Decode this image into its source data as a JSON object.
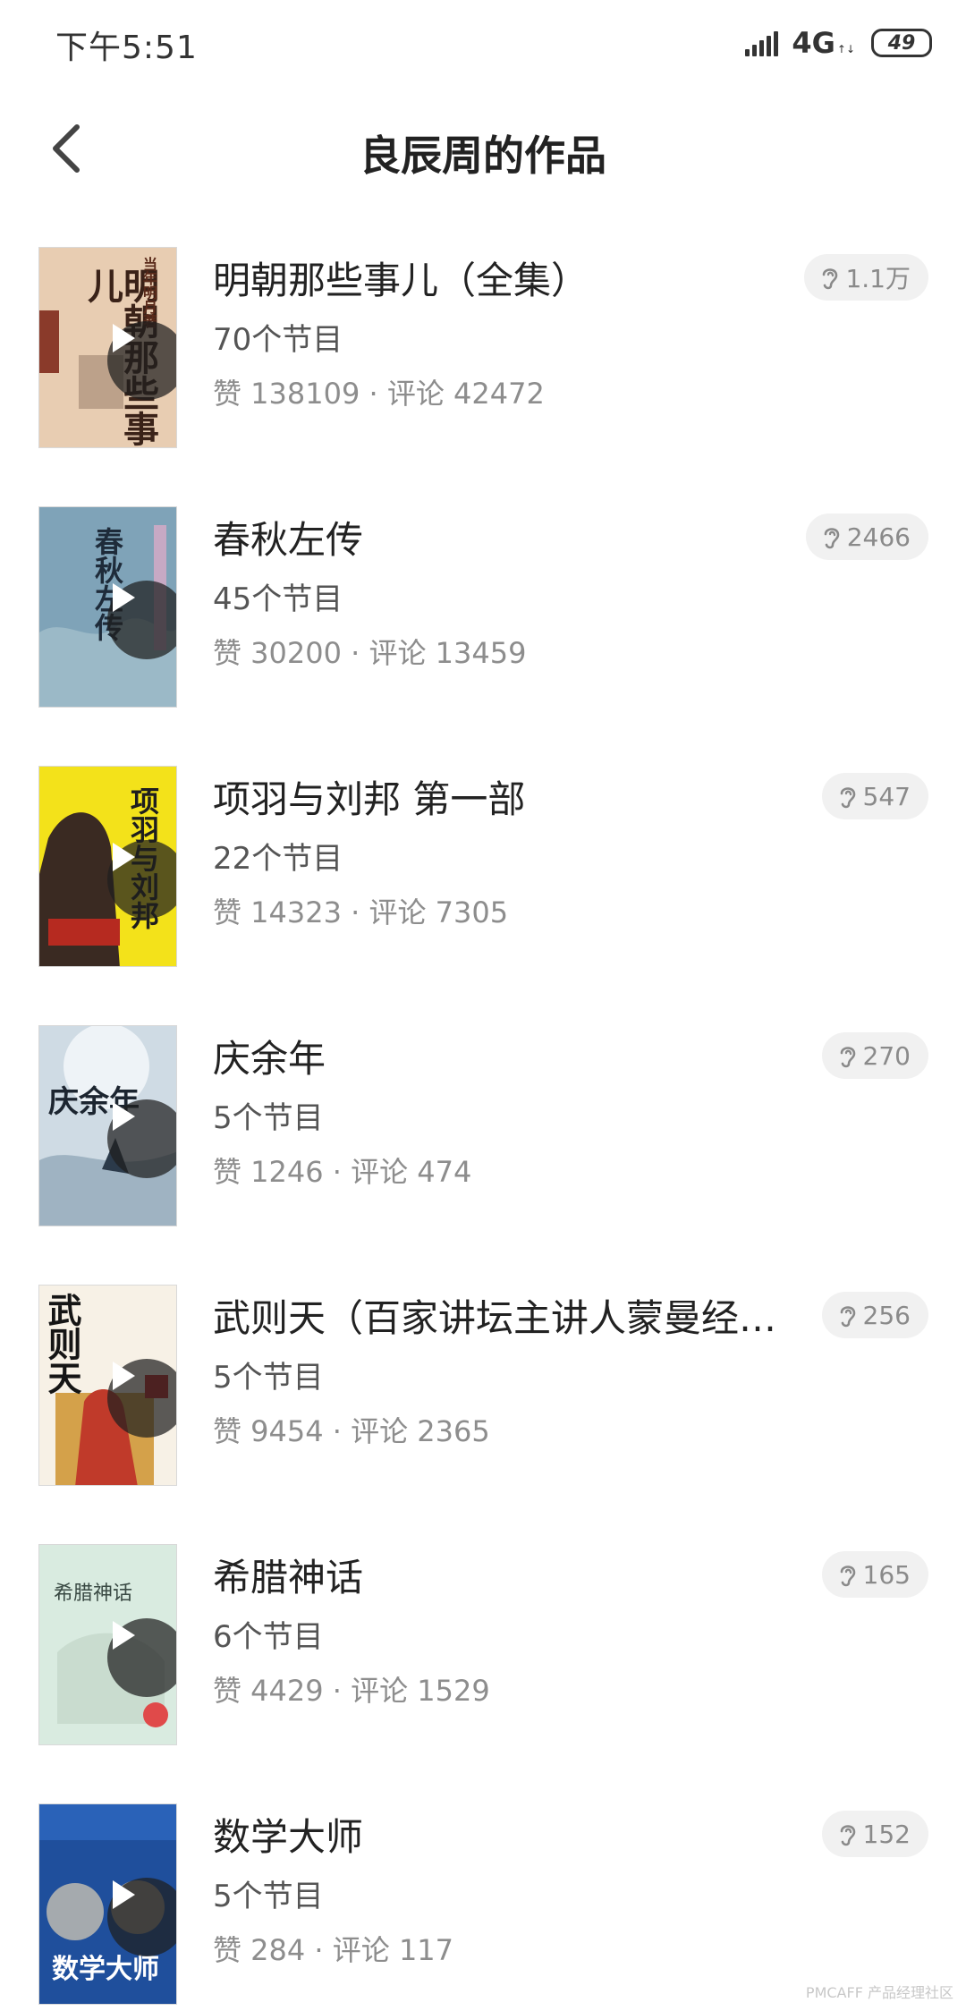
{
  "status_bar": {
    "time": "下午5:51",
    "network": "4G",
    "battery": "49"
  },
  "header": {
    "title": "良辰周的作品"
  },
  "works": [
    {
      "title": "明朝那些事儿（全集）",
      "episodes": "70个节目",
      "stats": "赞 138109 · 评论 42472",
      "listens": "1.1万",
      "cover_text": "明朝那些事儿",
      "cover_author": "当年明月著"
    },
    {
      "title": "春秋左传",
      "episodes": "45个节目",
      "stats": "赞 30200 · 评论 13459",
      "listens": "2466",
      "cover_text": "春秋左传"
    },
    {
      "title": "项羽与刘邦 第一部",
      "episodes": "22个节目",
      "stats": "赞 14323 · 评论 7305",
      "listens": "547",
      "cover_text": "项羽与刘邦"
    },
    {
      "title": "庆余年",
      "episodes": "5个节目",
      "stats": "赞 1246 · 评论 474",
      "listens": "270",
      "cover_text": "庆余年"
    },
    {
      "title": "武则天（百家讲坛主讲人蒙曼经…",
      "episodes": "5个节目",
      "stats": "赞 9454 · 评论 2365",
      "listens": "256",
      "cover_text": "武则天"
    },
    {
      "title": "希腊神话",
      "episodes": "6个节目",
      "stats": "赞 4429 · 评论 1529",
      "listens": "165",
      "cover_text": "希腊神话"
    },
    {
      "title": "数学大师",
      "episodes": "5个节目",
      "stats": "赞 284 · 评论 117",
      "listens": "152",
      "cover_text": "数学大师"
    }
  ],
  "watermark": "PMCAFF 产品经理社区",
  "icons": {
    "back": "chevron-left-icon",
    "play": "play-icon",
    "listen": "ear-icon"
  }
}
